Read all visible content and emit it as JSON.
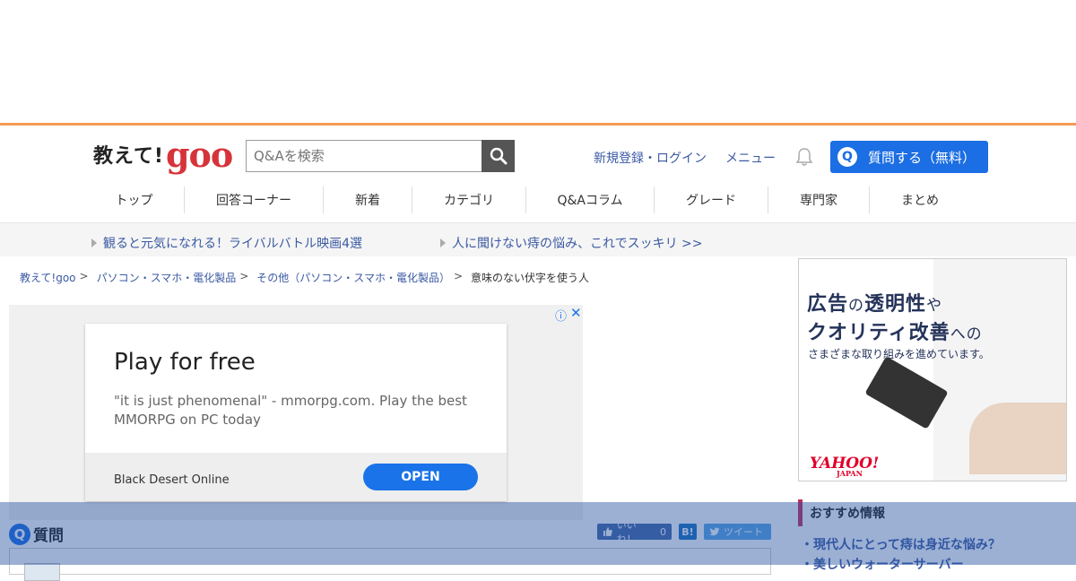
{
  "header": {
    "logo_text": "教えて!",
    "logo_brand": "goo",
    "search_placeholder": "Q&Aを検索",
    "register_login": "新規登録・ログイン",
    "menu": "メニュー",
    "ask_icon": "Q",
    "ask_button": "質問する（無料）"
  },
  "nav": [
    {
      "label": "トップ"
    },
    {
      "label": "回答コーナー"
    },
    {
      "label": "新着"
    },
    {
      "label": "カテゴリ"
    },
    {
      "label": "Q&Aコラム"
    },
    {
      "label": "グレード"
    },
    {
      "label": "専門家"
    },
    {
      "label": "まとめ"
    }
  ],
  "promo": [
    "観ると元気になれる！ライバルバトル映画4選",
    "人に聞けない痔の悩み、これでスッキリ >>"
  ],
  "breadcrumb": {
    "items": [
      "教えて!goo",
      "パソコン・スマホ・電化製品",
      "その他（パソコン・スマホ・電化製品）"
    ],
    "separator": ">",
    "current": "意味のない伏字を使う人"
  },
  "ad": {
    "title": "Play for free",
    "description": "\"it is just phenomenal\" - mmorpg.com. Play the best MMORPG on PC today",
    "brand": "Black Desert Online",
    "cta": "OPEN",
    "info_icon": "ⓘ",
    "close_icon": "✕"
  },
  "side_ad": {
    "line1_a": "広告",
    "line1_b": "の",
    "line1_c": "透明性",
    "line1_d": "や",
    "line2_a": "クオリティ改善",
    "line2_b": "への",
    "line3": "さまざまな取り組みを進めています。",
    "logo": "YAHOO!",
    "logo_sub": "JAPAN"
  },
  "question": {
    "icon": "Q",
    "heading": "質問",
    "like_label": "いいね！",
    "like_count": "0",
    "hatena": "B!",
    "tweet": "ツイート"
  },
  "recommend": {
    "title": "おすすめ情報",
    "items": [
      "・現代人にとって痔は身近な悩み？",
      "・美しいウォーターサーバー"
    ]
  },
  "colors": {
    "accent_orange": "#f39a55",
    "brand_red": "#d6333a",
    "link_blue": "#3b5aa3",
    "button_blue": "#1b6ee3"
  }
}
